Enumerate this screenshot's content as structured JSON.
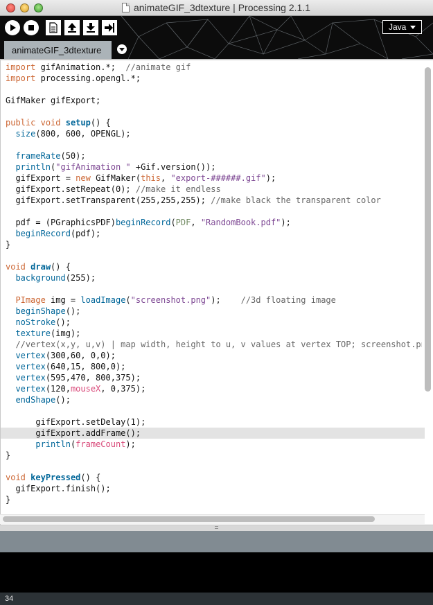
{
  "window": {
    "title": "animateGIF_3dtexture | Processing 2.1.1"
  },
  "toolbar": {
    "buttons": [
      {
        "name": "run-button",
        "icon": "play-icon"
      },
      {
        "name": "stop-button",
        "icon": "stop-icon"
      },
      {
        "name": "new-button",
        "icon": "new-document-icon"
      },
      {
        "name": "open-button",
        "icon": "upload-arrow-icon"
      },
      {
        "name": "save-button",
        "icon": "download-arrow-icon"
      },
      {
        "name": "export-button",
        "icon": "export-arrow-icon"
      }
    ],
    "mode": "Java"
  },
  "tabs": [
    {
      "label": "animateGIF_3dtexture",
      "active": true
    }
  ],
  "editor": {
    "current_line": 34,
    "lines": [
      [
        {
          "t": "import",
          "c": "kw"
        },
        {
          "t": " gifAnimation.*;  "
        },
        {
          "t": "//animate gif",
          "c": "cmt"
        }
      ],
      [
        {
          "t": "import",
          "c": "kw"
        },
        {
          "t": " processing.opengl.*;"
        }
      ],
      [],
      [
        {
          "t": "GifMaker gifExport;"
        }
      ],
      [],
      [
        {
          "t": "public",
          "c": "kw"
        },
        {
          "t": " "
        },
        {
          "t": "void",
          "c": "kw"
        },
        {
          "t": " "
        },
        {
          "t": "setup",
          "c": "bold-fn"
        },
        {
          "t": "() {"
        }
      ],
      [
        {
          "t": "  "
        },
        {
          "t": "size",
          "c": "fn"
        },
        {
          "t": "(800, 600, OPENGL);"
        }
      ],
      [],
      [
        {
          "t": "  "
        },
        {
          "t": "frameRate",
          "c": "fn"
        },
        {
          "t": "(50);"
        }
      ],
      [
        {
          "t": "  "
        },
        {
          "t": "println",
          "c": "fn"
        },
        {
          "t": "("
        },
        {
          "t": "\"gifAnimation \"",
          "c": "str"
        },
        {
          "t": " +Gif.version());"
        }
      ],
      [
        {
          "t": "  gifExport = "
        },
        {
          "t": "new",
          "c": "kw"
        },
        {
          "t": " GifMaker("
        },
        {
          "t": "this",
          "c": "kw"
        },
        {
          "t": ", "
        },
        {
          "t": "\"export-######.gif\"",
          "c": "str"
        },
        {
          "t": ");"
        }
      ],
      [
        {
          "t": "  gifExport.setRepeat(0); "
        },
        {
          "t": "//make it endless",
          "c": "cmt"
        }
      ],
      [
        {
          "t": "  gifExport.setTransparent(255,255,255); "
        },
        {
          "t": "//make black the transparent color",
          "c": "cmt"
        }
      ],
      [],
      [
        {
          "t": "  pdf = (PGraphicsPDF)"
        },
        {
          "t": "beginRecord",
          "c": "fn"
        },
        {
          "t": "("
        },
        {
          "t": "PDF",
          "c": "const"
        },
        {
          "t": ", "
        },
        {
          "t": "\"RandomBook.pdf\"",
          "c": "str"
        },
        {
          "t": ");"
        }
      ],
      [
        {
          "t": "  "
        },
        {
          "t": "beginRecord",
          "c": "fn"
        },
        {
          "t": "(pdf);"
        }
      ],
      [
        {
          "t": "}"
        }
      ],
      [],
      [
        {
          "t": "void",
          "c": "kw"
        },
        {
          "t": " "
        },
        {
          "t": "draw",
          "c": "bold-fn"
        },
        {
          "t": "() {"
        }
      ],
      [
        {
          "t": "  "
        },
        {
          "t": "background",
          "c": "fn"
        },
        {
          "t": "(255);"
        }
      ],
      [],
      [
        {
          "t": "  "
        },
        {
          "t": "PImage",
          "c": "kw"
        },
        {
          "t": " img = "
        },
        {
          "t": "loadImage",
          "c": "fn"
        },
        {
          "t": "("
        },
        {
          "t": "\"screenshot.png\"",
          "c": "str"
        },
        {
          "t": ");    "
        },
        {
          "t": "//3d floating image",
          "c": "cmt"
        }
      ],
      [
        {
          "t": "  "
        },
        {
          "t": "beginShape",
          "c": "fn"
        },
        {
          "t": "();"
        }
      ],
      [
        {
          "t": "  "
        },
        {
          "t": "noStroke",
          "c": "fn"
        },
        {
          "t": "();"
        }
      ],
      [
        {
          "t": "  "
        },
        {
          "t": "texture",
          "c": "fn"
        },
        {
          "t": "(img);"
        }
      ],
      [
        {
          "t": "  "
        },
        {
          "t": "//vertex(x,y, u,v) | map width, height to u, v values at vertex TOP; screenshot.png",
          "c": "cmt"
        }
      ],
      [
        {
          "t": "  "
        },
        {
          "t": "vertex",
          "c": "fn"
        },
        {
          "t": "(300,60, 0,0);"
        }
      ],
      [
        {
          "t": "  "
        },
        {
          "t": "vertex",
          "c": "fn"
        },
        {
          "t": "(640,15, 800,0);"
        }
      ],
      [
        {
          "t": "  "
        },
        {
          "t": "vertex",
          "c": "fn"
        },
        {
          "t": "(595,470, 800,375);"
        }
      ],
      [
        {
          "t": "  "
        },
        {
          "t": "vertex",
          "c": "fn"
        },
        {
          "t": "(120,"
        },
        {
          "t": "mouseX",
          "c": "sys"
        },
        {
          "t": ", 0,375);"
        }
      ],
      [
        {
          "t": "  "
        },
        {
          "t": "endShape",
          "c": "fn"
        },
        {
          "t": "();"
        }
      ],
      [],
      [
        {
          "t": "      gifExport.setDelay(1);"
        }
      ],
      [
        {
          "t": "      gifExport.addFrame();"
        }
      ],
      [
        {
          "t": "      "
        },
        {
          "t": "println",
          "c": "fn"
        },
        {
          "t": "("
        },
        {
          "t": "frameCount",
          "c": "sys"
        },
        {
          "t": ");"
        }
      ],
      [
        {
          "t": "}"
        }
      ],
      [],
      [
        {
          "t": "void",
          "c": "kw"
        },
        {
          "t": " "
        },
        {
          "t": "keyPressed",
          "c": "bold-fn"
        },
        {
          "t": "() {"
        }
      ],
      [
        {
          "t": "  gifExport.finish();"
        }
      ],
      [
        {
          "t": "}"
        }
      ]
    ]
  },
  "status": {
    "line_number": "34"
  },
  "colors": {
    "keyword": "#cc6633",
    "function": "#006699",
    "string": "#7d4793",
    "comment": "#666666",
    "toolbar_bg": "#0c0c0c",
    "tab_bg": "#abb3b8",
    "status_bar": "#818b92",
    "console_bg": "#000000"
  }
}
